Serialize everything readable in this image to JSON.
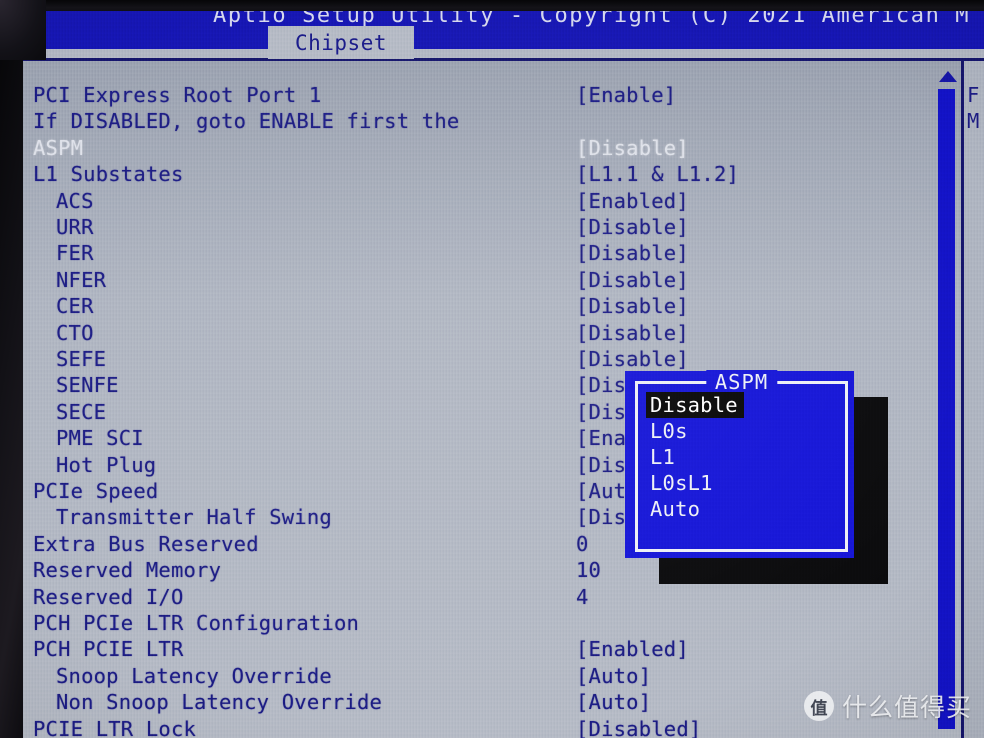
{
  "window": {
    "title": "Aptio Setup Utility - Copyright (C) 2021 American M",
    "active_tab": "Chipset"
  },
  "colors": {
    "titlebar_blue": "#1616b4",
    "panel_gray": "#b0b6c2",
    "text_blue": "#1c1c86",
    "dialog_blue": "#1616d8",
    "highlight_white": "#dfe2ea",
    "selection_black": "#080808"
  },
  "settings_rows": [
    {
      "label": "PCI Express Root Port 1",
      "indent": 0,
      "value": "[Enable]",
      "selected": false
    },
    {
      "label": "If DISABLED, goto ENABLE first the",
      "indent": 0,
      "value": "",
      "selected": false
    },
    {
      "label": "ASPM",
      "indent": 0,
      "value": "[Disable]",
      "selected": true
    },
    {
      "label": "L1 Substates",
      "indent": 0,
      "value": "[L1.1 & L1.2]",
      "selected": false
    },
    {
      "label": "ACS",
      "indent": 1,
      "value": "[Enabled]",
      "selected": false
    },
    {
      "label": "URR",
      "indent": 1,
      "value": "[Disable]",
      "selected": false
    },
    {
      "label": "FER",
      "indent": 1,
      "value": "[Disable]",
      "selected": false
    },
    {
      "label": "NFER",
      "indent": 1,
      "value": "[Disable]",
      "selected": false
    },
    {
      "label": "CER",
      "indent": 1,
      "value": "[Disable]",
      "selected": false
    },
    {
      "label": "CTO",
      "indent": 1,
      "value": "[Disable]",
      "selected": false
    },
    {
      "label": "SEFE",
      "indent": 1,
      "value": "[Disable]",
      "selected": false
    },
    {
      "label": "SENFE",
      "indent": 1,
      "value": "[Disable]",
      "selected": false
    },
    {
      "label": "SECE",
      "indent": 1,
      "value": "[Disable]",
      "selected": false
    },
    {
      "label": "PME SCI",
      "indent": 1,
      "value": "[Enable]",
      "selected": false
    },
    {
      "label": "Hot Plug",
      "indent": 1,
      "value": "[Disable]",
      "selected": false
    },
    {
      "label": "PCIe Speed",
      "indent": 0,
      "value": "[Auto]",
      "selected": false
    },
    {
      "label": "Transmitter Half Swing",
      "indent": 1,
      "value": "[Disable]",
      "selected": false
    },
    {
      "label": "Extra Bus Reserved",
      "indent": 0,
      "value": "0",
      "selected": false
    },
    {
      "label": "Reserved Memory",
      "indent": 0,
      "value": "10",
      "selected": false
    },
    {
      "label": "Reserved I/O",
      "indent": 0,
      "value": "4",
      "selected": false
    },
    {
      "label": "PCH PCIe LTR Configuration",
      "indent": 0,
      "value": "",
      "selected": false
    },
    {
      "label": "PCH PCIE LTR",
      "indent": 0,
      "value": "[Enabled]",
      "selected": false
    },
    {
      "label": "Snoop Latency Override",
      "indent": 1,
      "value": "[Auto]",
      "selected": false
    },
    {
      "label": "Non Snoop Latency Override",
      "indent": 1,
      "value": "[Auto]",
      "selected": false
    },
    {
      "label": "PCIE LTR Lock",
      "indent": 0,
      "value": "[Disabled]",
      "selected": false
    }
  ],
  "dialog": {
    "title": "ASPM",
    "options": [
      {
        "label": "Disable",
        "highlighted": true
      },
      {
        "label": "L0s",
        "highlighted": false
      },
      {
        "label": "L1",
        "highlighted": false
      },
      {
        "label": "L0sL1",
        "highlighted": false
      },
      {
        "label": "Auto",
        "highlighted": false
      }
    ]
  },
  "help_panel": {
    "lines": [
      "F",
      "M"
    ]
  },
  "scrollbar": {
    "up_arrow": "scroll-up-arrow"
  },
  "watermark": {
    "badge": "值",
    "text": "什么值得买"
  }
}
